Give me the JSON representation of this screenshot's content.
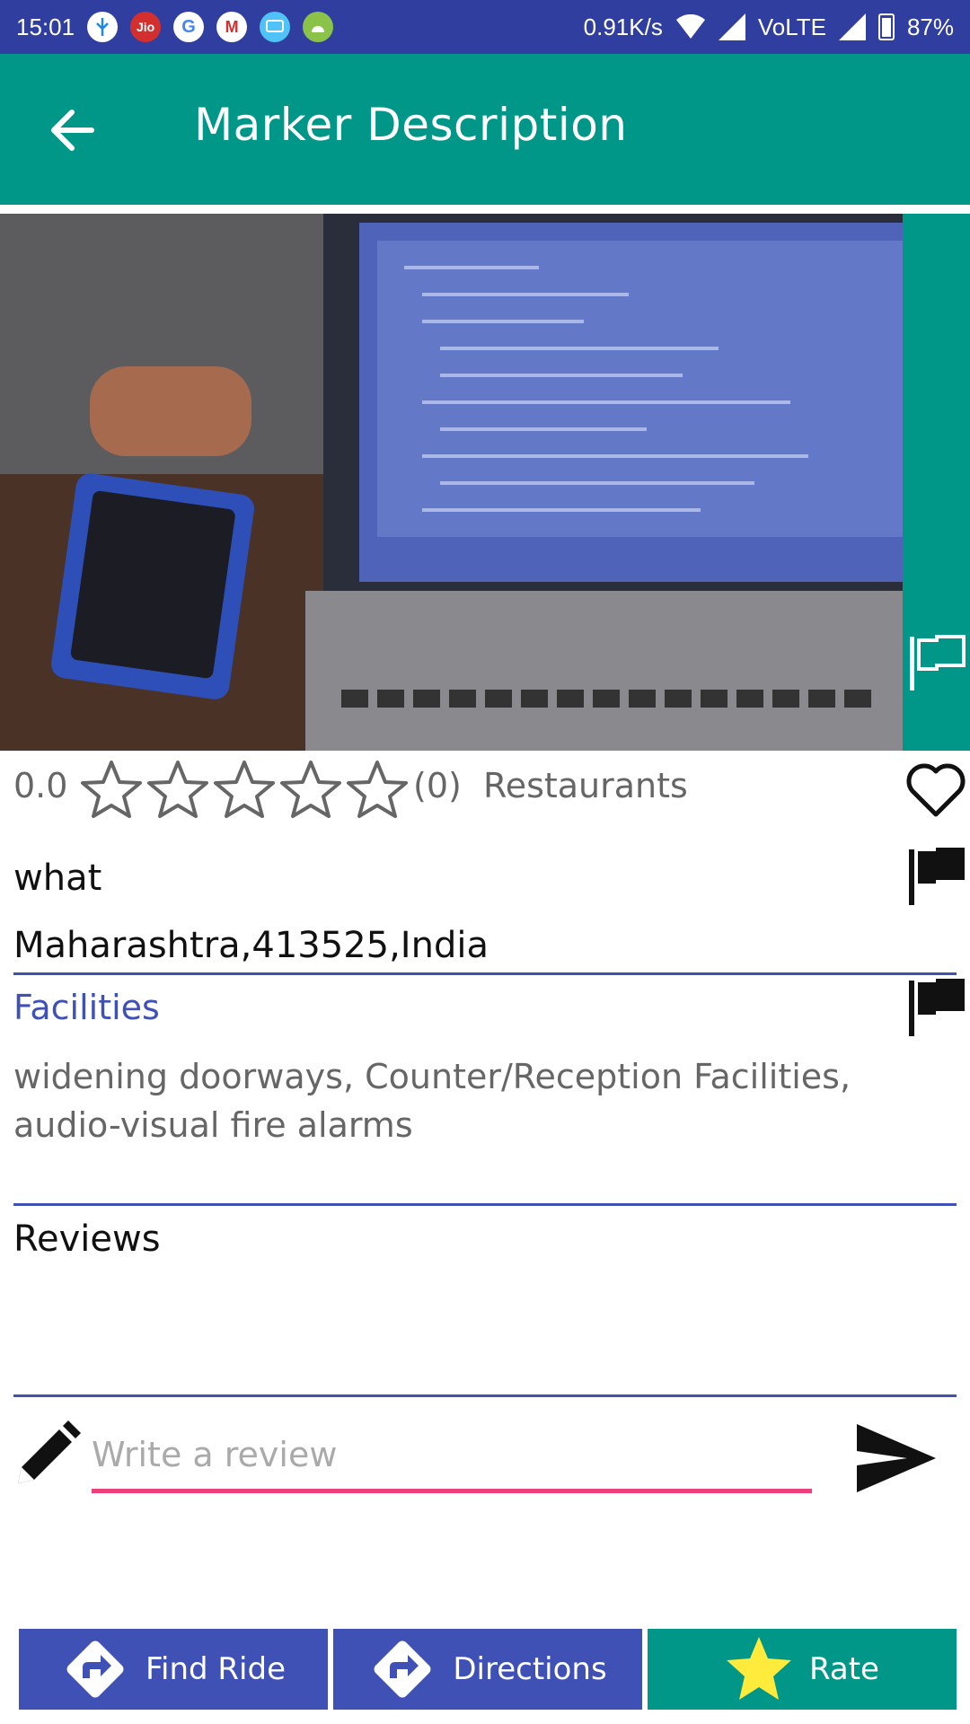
{
  "status_bar": {
    "time": "15:01",
    "speed": "0.91K/s",
    "network": "VoLTE",
    "battery": "87%",
    "notification_icons": [
      "usb-icon",
      "jio-icon",
      "google-icon",
      "gmail-icon",
      "cast-icon",
      "android-icon"
    ],
    "jio_label": "Jio",
    "google_label": "G",
    "gmail_label": "M"
  },
  "app_bar": {
    "title": "Marker Description",
    "back_icon": "arrow-back-icon",
    "color": "#009688"
  },
  "place": {
    "rating": "0.0",
    "stars_filled": 0,
    "stars_total": 5,
    "rating_count": "(0)",
    "category": "Restaurants",
    "name": "what",
    "address": "Maharashtra,413525,India"
  },
  "facilities": {
    "label": "Facilities",
    "text": "widening doorways, Counter/Reception Facilities, audio-visual fire alarms"
  },
  "reviews": {
    "label": "Reviews"
  },
  "review_input": {
    "placeholder": "Write a review",
    "value": ""
  },
  "bottom_buttons": {
    "find_ride": "Find Ride",
    "directions": "Directions",
    "rate": "Rate"
  },
  "colors": {
    "status_bar": "#303f9f",
    "primary": "#009688",
    "accent_blue": "#3f51b5",
    "input_underline": "#ec407a",
    "rate_star": "#ffeb3b"
  }
}
